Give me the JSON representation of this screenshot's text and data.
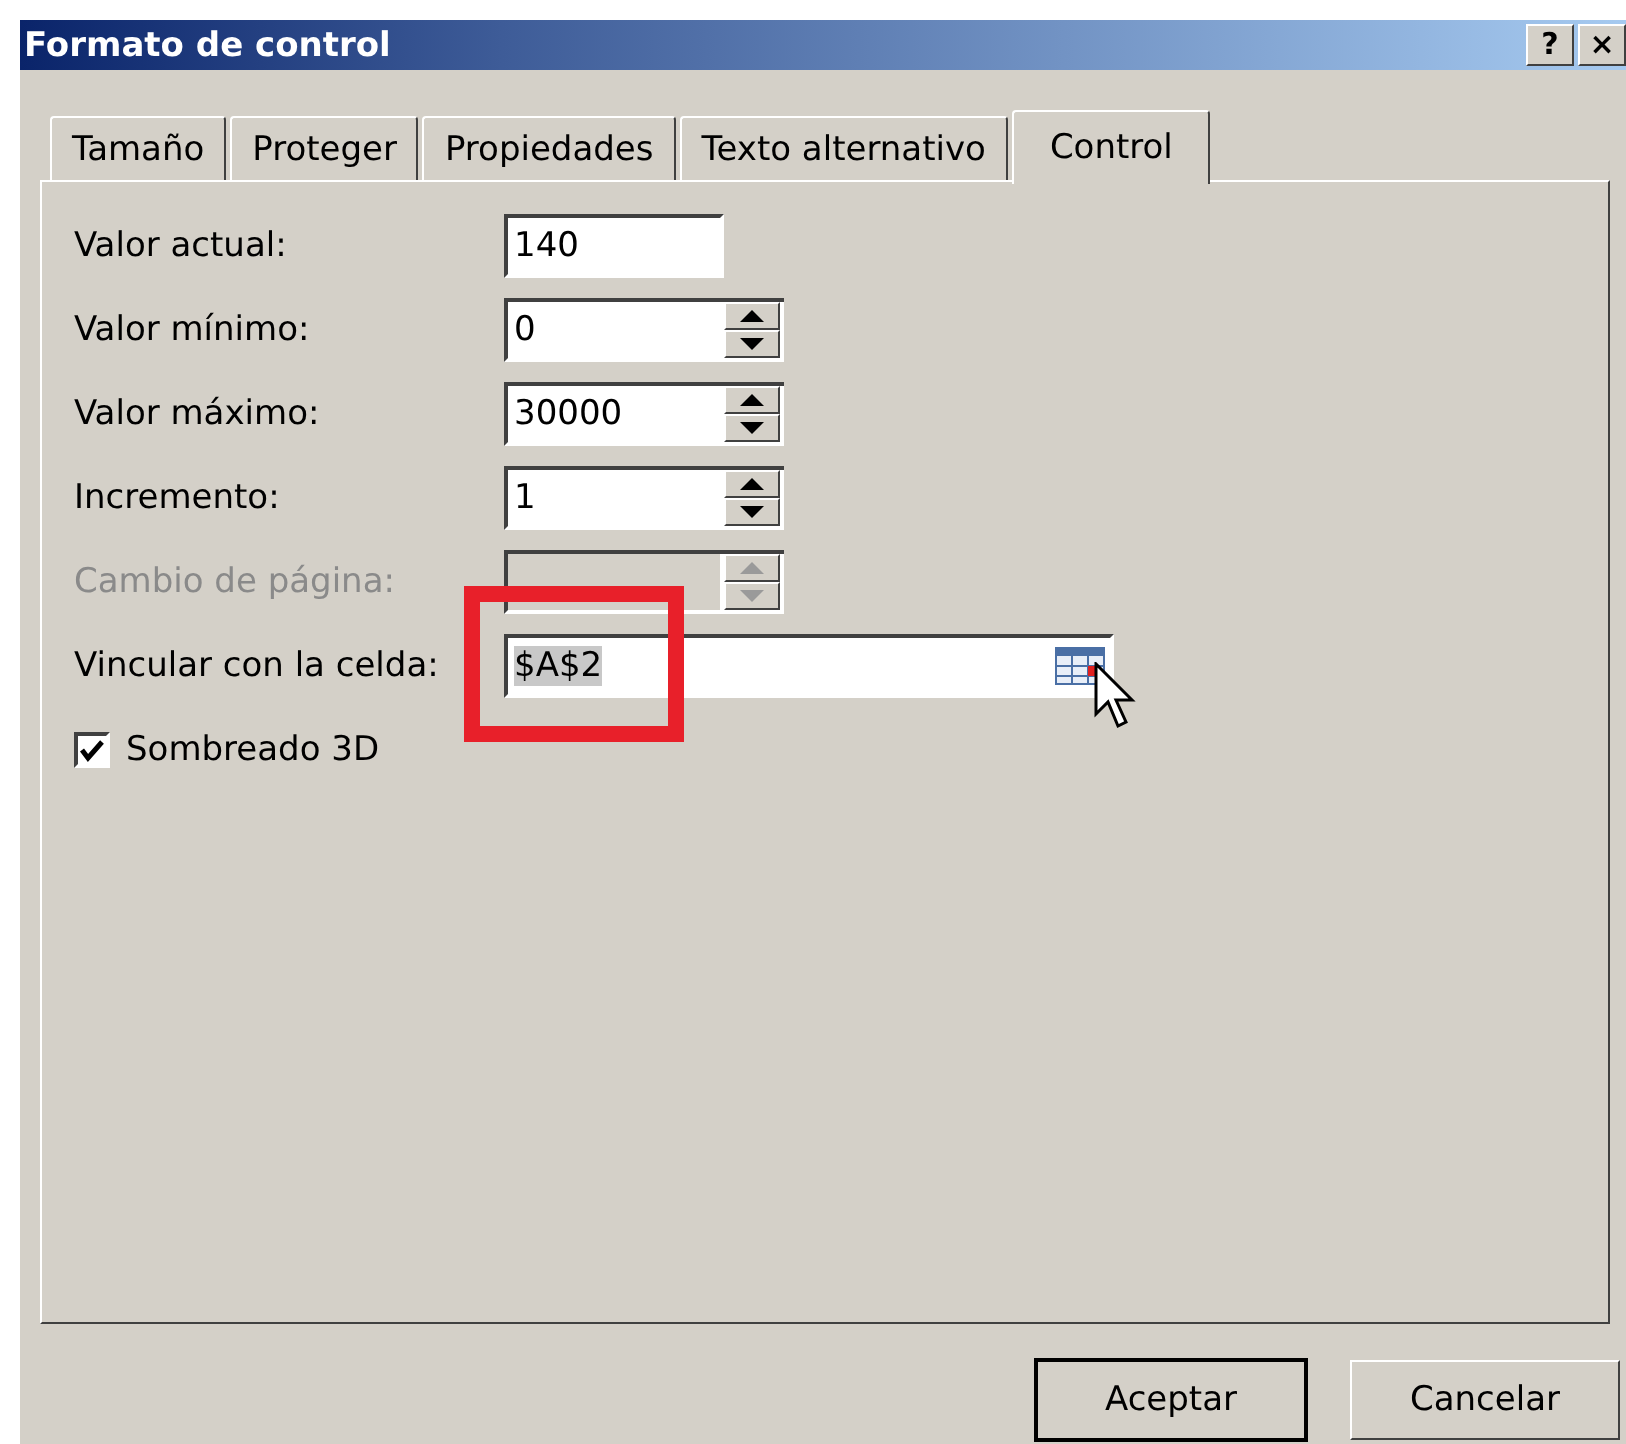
{
  "window": {
    "title": "Formato de control",
    "buttons": [
      "?",
      "×"
    ]
  },
  "tabs": [
    {
      "label": "Tamaño",
      "selected": false
    },
    {
      "label": "Proteger",
      "selected": false
    },
    {
      "label": "Propiedades",
      "selected": false
    },
    {
      "label": "Texto alternativo",
      "selected": false
    },
    {
      "label": "Control",
      "selected": true
    }
  ],
  "fields": [
    {
      "kind": "text",
      "label": "Valor actual:",
      "value": "140",
      "disabled": false
    },
    {
      "kind": "spin",
      "label": "Valor mínimo:",
      "value": "0",
      "disabled": false
    },
    {
      "kind": "spin",
      "label": "Valor máximo:",
      "value": "30000",
      "disabled": false
    },
    {
      "kind": "spin",
      "label": "Incremento:",
      "value": "1",
      "disabled": false
    },
    {
      "kind": "spin",
      "label": "Cambio de página:",
      "disabled": true
    },
    {
      "kind": "ref",
      "label": "Vincular con la celda:",
      "value": "$A$2",
      "disabled": false,
      "highlighted": true
    }
  ],
  "checkbox": {
    "label": "Sombreado 3D",
    "checked": true
  },
  "buttons": [
    {
      "label": "Aceptar",
      "default": true
    },
    {
      "label": "Cancelar",
      "default": false
    }
  ]
}
